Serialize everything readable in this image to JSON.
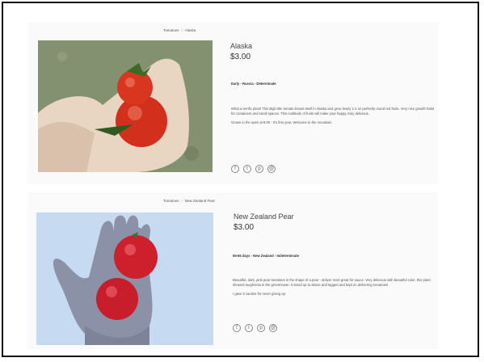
{
  "products": [
    {
      "breadcrumb": [
        "Tomatoes",
        "Alaska"
      ],
      "name": "Alaska",
      "price": "$3.00",
      "tags": "Early - Russia - Determinate",
      "description": [
        "What a terrific plant! This Bigh title tomato knows itself in Alaska and grew lovely 1-2 oz perfectly round red fruits. Very nice growth habit for containers and small spaces. This multitude of fruits will make your happy, truly delicious.",
        "Grown in the open at 8:00 - It's first year. Welcome to the mountain."
      ],
      "image_colors": {
        "bg": "#7a8a6a",
        "hand": "#e9d7c4",
        "tomato": "#d8331c"
      }
    },
    {
      "breadcrumb": [
        "Tomatoes",
        "New Zealand Pear"
      ],
      "name": "New Zealand Pear",
      "price": "$3.00",
      "tags": "55-65 days - New Zealand - Indeterminate",
      "description": [
        "Beautiful, dark, pink pear tomatoes in the shape of a pear - deliver most great for sauce. Very delicious with beautiful color, this plant showed toughness in the greenhouse. It stood up to abuse and lagged and kept on delivering tomatoes!",
        "I gave it caution for never giving up."
      ],
      "image_colors": {
        "bg": "#c9dcf0",
        "hand": "#8f94a8",
        "tomato": "#cf2230"
      }
    }
  ],
  "social_icons": [
    "facebook-icon",
    "twitter-icon",
    "pinterest-icon",
    "email-icon"
  ]
}
